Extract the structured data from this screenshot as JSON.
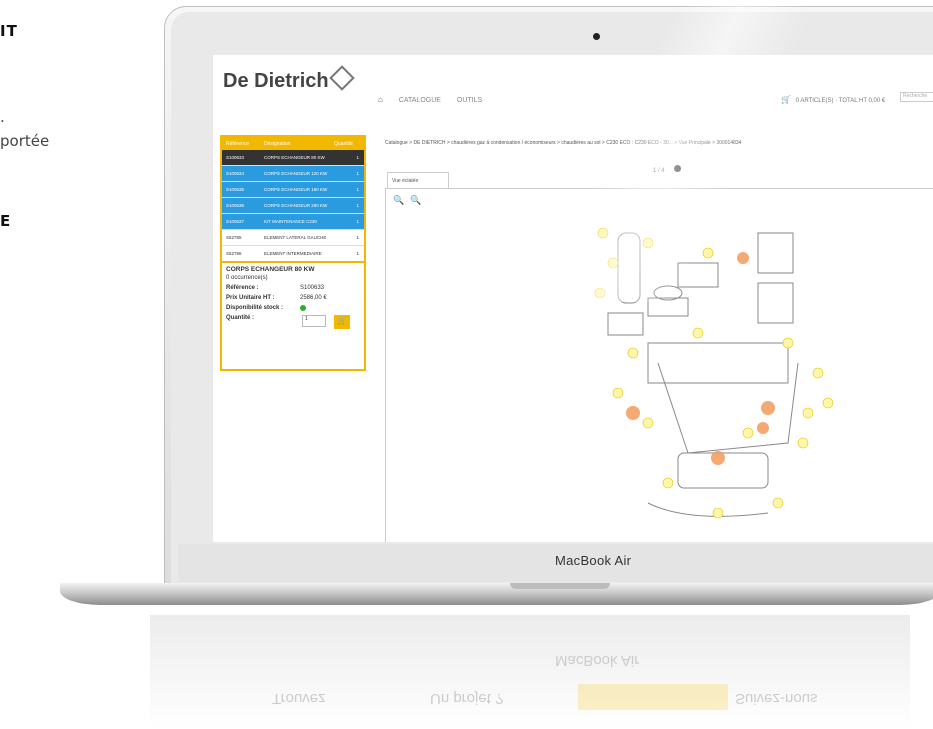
{
  "left_column": {
    "line1": "IT",
    "line2": ".",
    "line3": "portée",
    "line4": "E"
  },
  "laptop": {
    "brand_label": "MacBook Air"
  },
  "screen": {
    "logo": "De Dietrich",
    "nav": {
      "catalogue": "CATALOGUE",
      "outils": "OUTILS"
    },
    "cart_summary": "0 ARTICLE(S) · TOTAL HT 0,00 €",
    "search_placeholder": "Recherche",
    "parts_table": {
      "headers": [
        "Référence",
        "Désignation",
        "Quantité"
      ],
      "rows": [
        {
          "ref": "S100633",
          "name": "CORPS ECHANGEUR 80 KW",
          "qty": "1",
          "state": "dark"
        },
        {
          "ref": "S100634",
          "name": "CORPS ECHANGEUR 120 KW",
          "qty": "1",
          "state": "blue"
        },
        {
          "ref": "S100635",
          "name": "CORPS ECHANGEUR 160 KW",
          "qty": "1",
          "state": "blue"
        },
        {
          "ref": "S100636",
          "name": "CORPS ECHANGEUR 200 KW",
          "qty": "1",
          "state": "blue"
        },
        {
          "ref": "S100637",
          "name": "KIT MAINTENANCE C230",
          "qty": "1",
          "state": "blue"
        },
        {
          "ref": "S52785",
          "name": "ELEMENT LATERAL GAUCHE",
          "qty": "1",
          "state": "plain"
        },
        {
          "ref": "S52786",
          "name": "ELEMENT INTERMEDIAIRE",
          "qty": "1",
          "state": "plain"
        }
      ]
    },
    "detail": {
      "title": "CORPS ECHANGEUR 80 KW",
      "occurrences": "0 occurrence(s)",
      "reference_label": "Référence :",
      "reference_value": "S100633",
      "price_label": "Prix Unitaire HT :",
      "price_value": "2586,00 €",
      "stock_label": "Disponibilité stock :",
      "quantity_label": "Quantité :",
      "quantity_value": "1"
    },
    "breadcrumb": "Catalogue > DE DIETRICH > chaudières gaz à condensation / économiseurs > chaudières au sol > C230 ECO : C230 ECO - 30... > Vue Principale > 300014834",
    "pager": "1 / 4",
    "tab_label": "Vue éclatée",
    "zoom_in": "🔍",
    "zoom_out": "🔍"
  },
  "reflection": {
    "r1": "MacBook Air",
    "r2": "Trouvez",
    "r3": "Un projet ?",
    "r4": "Suivez-nous"
  },
  "colors": {
    "accent_yellow": "#f2b800",
    "row_blue": "#2b9be0",
    "row_dark": "#333333",
    "marker_orange": "#f39a5b"
  }
}
